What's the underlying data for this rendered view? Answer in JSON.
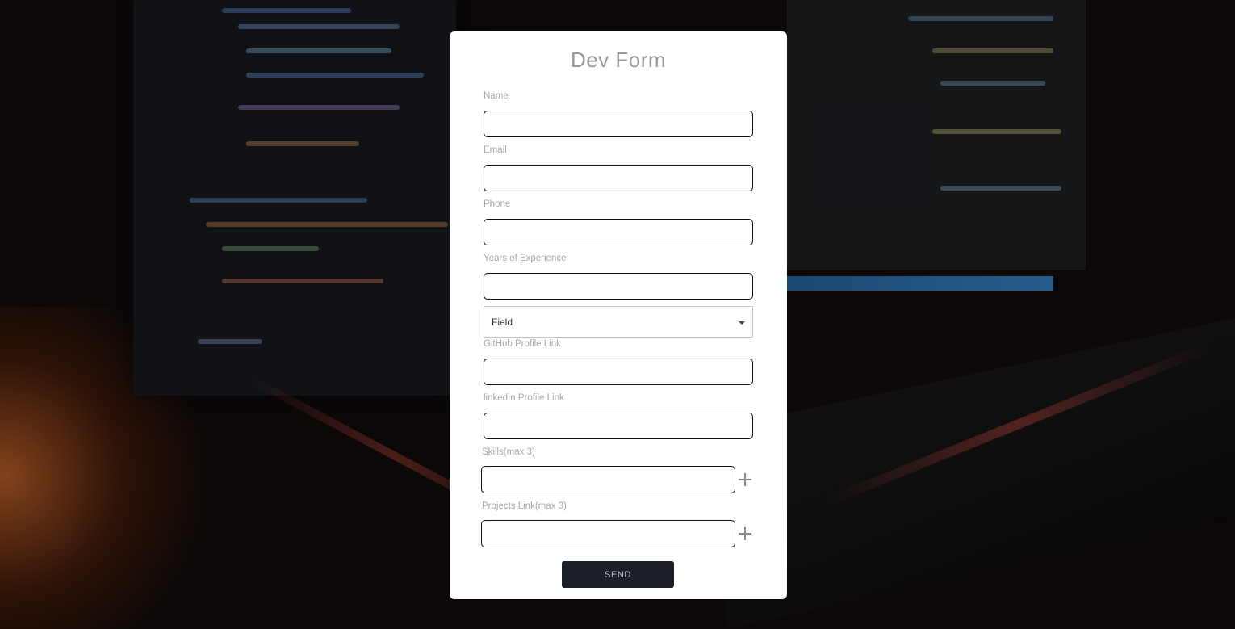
{
  "form": {
    "title": "Dev Form",
    "fields": {
      "name": {
        "label": "Name",
        "value": ""
      },
      "email": {
        "label": "Email",
        "value": ""
      },
      "phone": {
        "label": "Phone",
        "value": ""
      },
      "experience": {
        "label": "Years of Experience",
        "value": ""
      },
      "field_select": {
        "value": "Field"
      },
      "github": {
        "label": "GitHub Profile Link",
        "value": ""
      },
      "linkedin": {
        "label": "linkedIn Profile Link",
        "value": ""
      },
      "skills": {
        "label": "Skills(max 3)",
        "value": ""
      },
      "projects": {
        "label": "Projects Link(max 3)",
        "value": ""
      }
    },
    "send_label": "SEND"
  },
  "icons": {
    "select_arrow": "caret-down-icon",
    "add_skill": "plus-icon",
    "add_project": "plus-icon"
  }
}
